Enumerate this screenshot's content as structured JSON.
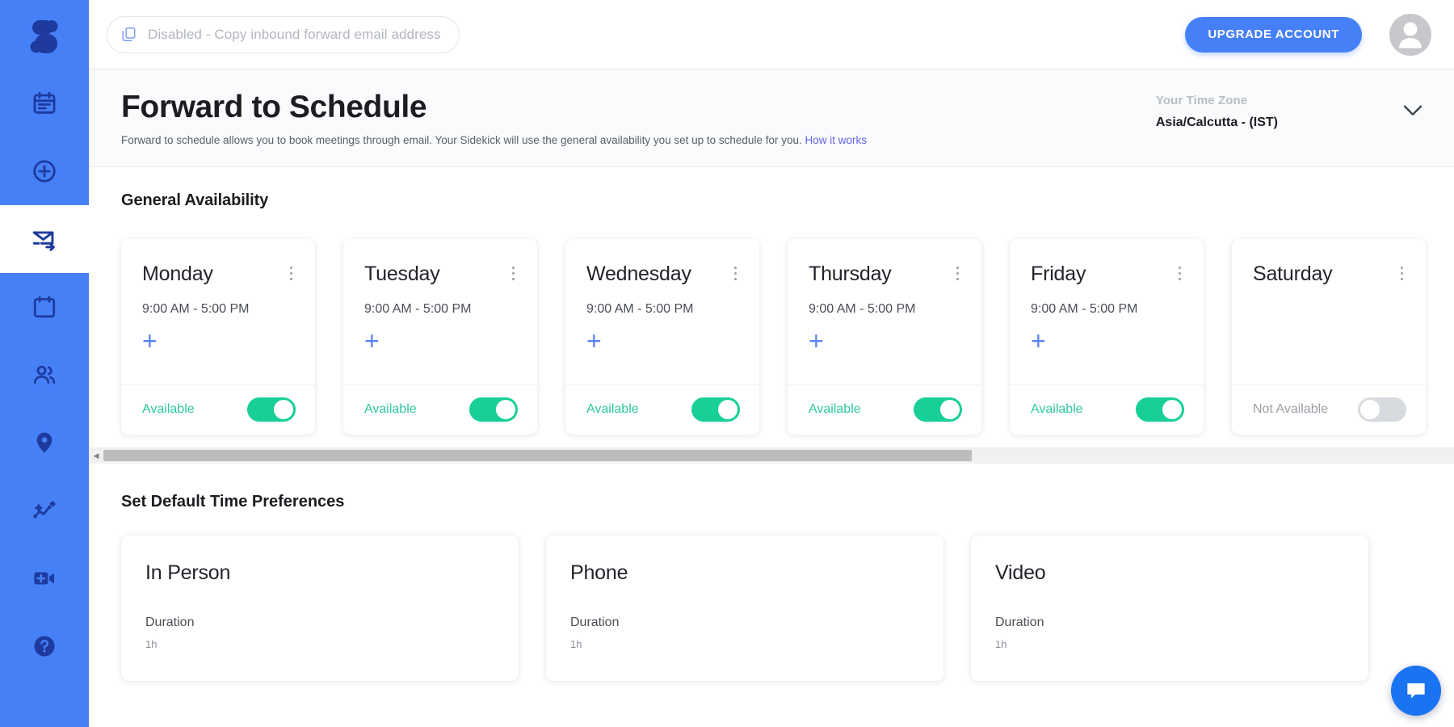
{
  "sidebar": {
    "logo_name": "sidekick-logo",
    "items": [
      {
        "name": "agenda-icon",
        "label": "Agenda"
      },
      {
        "name": "add-circle-icon",
        "label": "Create"
      },
      {
        "name": "mail-forward-icon",
        "label": "Forward to Schedule",
        "active": true
      },
      {
        "name": "calendar-icon",
        "label": "Calendar"
      },
      {
        "name": "contacts-icon",
        "label": "Contacts"
      },
      {
        "name": "location-pin-icon",
        "label": "Locations"
      },
      {
        "name": "analytics-icon",
        "label": "Analytics"
      },
      {
        "name": "video-add-icon",
        "label": "Video Meeting"
      },
      {
        "name": "help-circle-icon",
        "label": "Help"
      }
    ]
  },
  "topbar": {
    "copy_pill_text": "Disabled - Copy inbound forward email address",
    "copy_icon": "copy-icon",
    "upgrade_label": "UPGRADE ACCOUNT",
    "avatar_name": "user-avatar"
  },
  "page": {
    "title": "Forward to Schedule",
    "subtitle_before": "Forward to schedule allows you to book meetings through email. Your Sidekick will use the general availability you set up to schedule for you.",
    "subtitle_link": "How it works",
    "timezone_label": "Your Time Zone",
    "timezone_value": "Asia/Calcutta - (IST)",
    "chevron_icon": "chevron-down-icon"
  },
  "availability": {
    "section_title": "General Availability",
    "days": [
      {
        "name": "Monday",
        "slot": "9:00 AM - 5:00 PM",
        "status": "Available",
        "on": true
      },
      {
        "name": "Tuesday",
        "slot": "9:00 AM - 5:00 PM",
        "status": "Available",
        "on": true
      },
      {
        "name": "Wednesday",
        "slot": "9:00 AM - 5:00 PM",
        "status": "Available",
        "on": true
      },
      {
        "name": "Thursday",
        "slot": "9:00 AM - 5:00 PM",
        "status": "Available",
        "on": true
      },
      {
        "name": "Friday",
        "slot": "9:00 AM - 5:00 PM",
        "status": "Available",
        "on": true
      },
      {
        "name": "Saturday",
        "slot": "",
        "status": "Not Available",
        "on": false
      }
    ],
    "add_slot_glyph": "+"
  },
  "preferences": {
    "section_title": "Set Default Time Preferences",
    "cards": [
      {
        "name": "In Person",
        "duration_label": "Duration",
        "duration_value": "1h"
      },
      {
        "name": "Phone",
        "duration_label": "Duration",
        "duration_value": "1h"
      },
      {
        "name": "Video",
        "duration_label": "Duration",
        "duration_value": "1h"
      }
    ]
  },
  "chat": {
    "icon": "chat-bubble-icon"
  },
  "colors": {
    "sidebar_blue": "#4680f7",
    "icon_navy": "#1e3a9e",
    "toggle_green": "#17cf97",
    "available_green": "#2dc9a0",
    "link_purple": "#6366e8",
    "chat_blue": "#1a73f0"
  }
}
